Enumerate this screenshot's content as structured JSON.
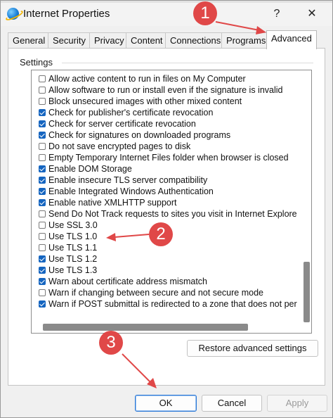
{
  "window": {
    "title": "Internet Properties",
    "help_label": "?",
    "close_label": "✕"
  },
  "tabs": [
    {
      "label": "General",
      "active": false
    },
    {
      "label": "Security",
      "active": false
    },
    {
      "label": "Privacy",
      "active": false
    },
    {
      "label": "Content",
      "active": false
    },
    {
      "label": "Connections",
      "active": false
    },
    {
      "label": "Programs",
      "active": false
    },
    {
      "label": "Advanced",
      "active": true
    }
  ],
  "settings": {
    "group_label": "Settings",
    "items": [
      {
        "label": "Allow active content to run in files on My Computer",
        "checked": false
      },
      {
        "label": "Allow software to run or install even if the signature is invalid",
        "checked": false
      },
      {
        "label": "Block unsecured images with other mixed content",
        "checked": false
      },
      {
        "label": "Check for publisher's certificate revocation",
        "checked": true
      },
      {
        "label": "Check for server certificate revocation",
        "checked": true
      },
      {
        "label": "Check for signatures on downloaded programs",
        "checked": true
      },
      {
        "label": "Do not save encrypted pages to disk",
        "checked": false
      },
      {
        "label": "Empty Temporary Internet Files folder when browser is closed",
        "checked": false
      },
      {
        "label": "Enable DOM Storage",
        "checked": true
      },
      {
        "label": "Enable insecure TLS server compatibility",
        "checked": true
      },
      {
        "label": "Enable Integrated Windows Authentication",
        "checked": true
      },
      {
        "label": "Enable native XMLHTTP support",
        "checked": true
      },
      {
        "label": "Send Do Not Track requests to sites you visit in Internet Explore",
        "checked": false
      },
      {
        "label": "Use SSL 3.0",
        "checked": false
      },
      {
        "label": "Use TLS 1.0",
        "checked": false
      },
      {
        "label": "Use TLS 1.1",
        "checked": false
      },
      {
        "label": "Use TLS 1.2",
        "checked": true
      },
      {
        "label": "Use TLS 1.3",
        "checked": true
      },
      {
        "label": "Warn about certificate address mismatch",
        "checked": true
      },
      {
        "label": "Warn if changing between secure and not secure mode",
        "checked": false
      },
      {
        "label": "Warn if POST submittal is redirected to a zone that does not per",
        "checked": true
      }
    ],
    "restore_label": "Restore advanced settings"
  },
  "footer": {
    "ok_label": "OK",
    "cancel_label": "Cancel",
    "apply_label": "Apply"
  },
  "annotations": {
    "step1": "1",
    "step2": "2",
    "step3": "3",
    "color": "#e04848"
  }
}
